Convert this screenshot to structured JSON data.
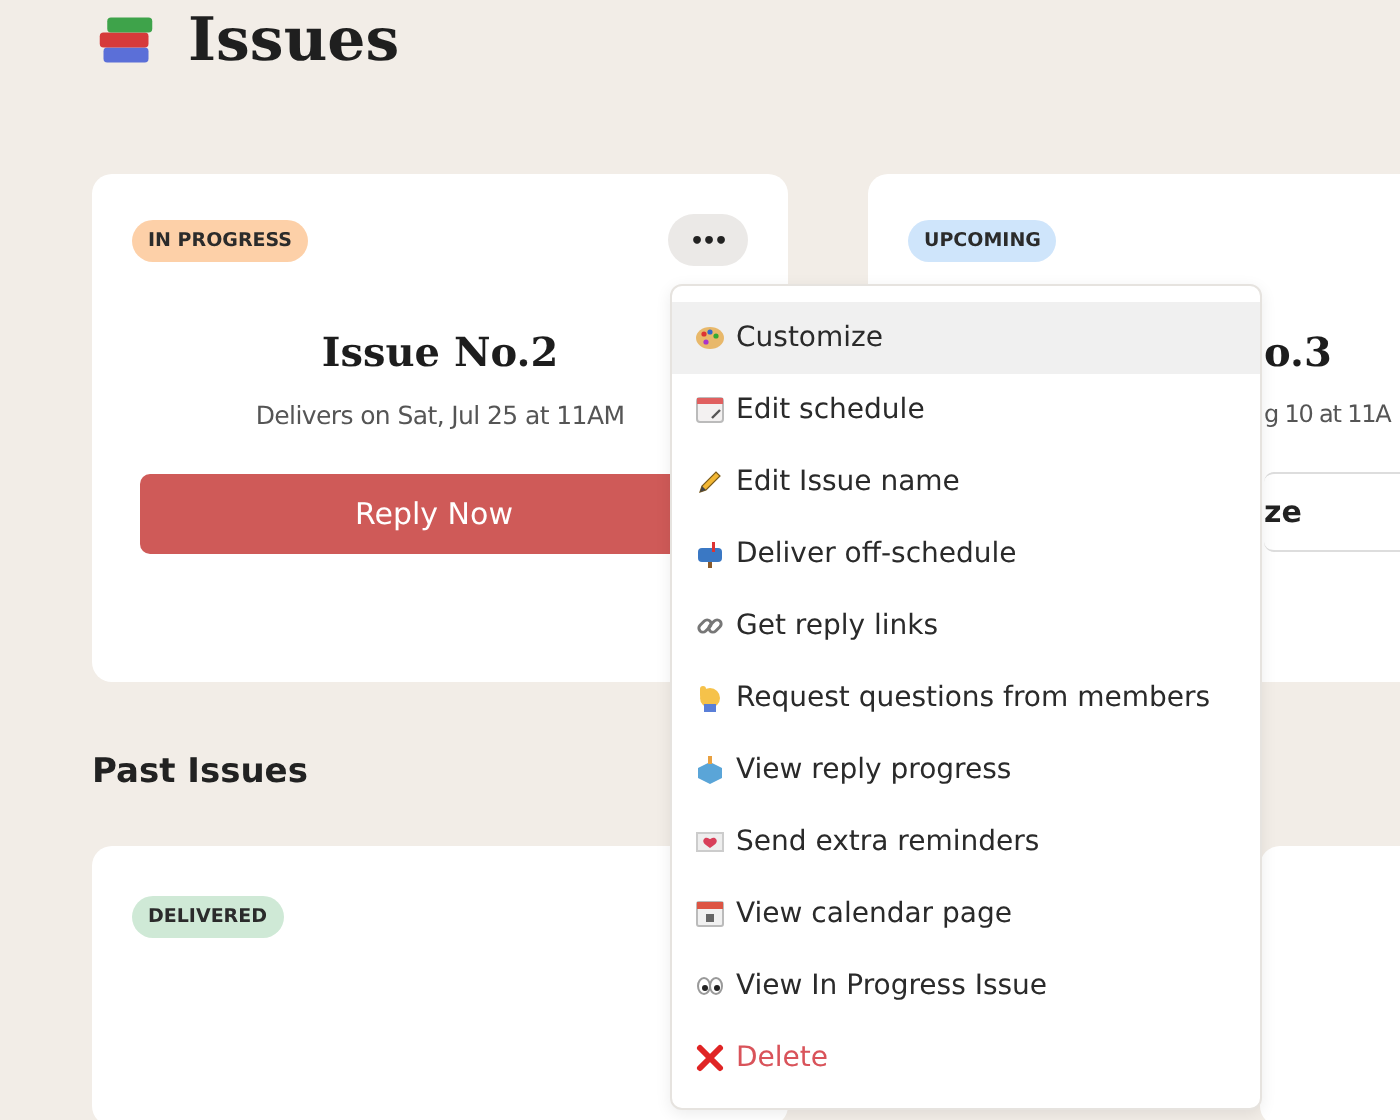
{
  "page": {
    "title": "Issues"
  },
  "current_issues": [
    {
      "badge": {
        "label": "IN PROGRESS",
        "color": "#fdd0a8"
      },
      "menu_button": "•••",
      "title": "Issue No.2",
      "schedule": "Delivers on Sat, Jul 25 at 11AM",
      "action": {
        "label": "Reply Now",
        "kind": "primary"
      }
    },
    {
      "badge": {
        "label": "UPCOMING",
        "color": "#cfe5fb"
      },
      "title": "o.3",
      "schedule": "g 10 at 11A",
      "action": {
        "label": "ze",
        "kind": "outline"
      }
    }
  ],
  "past_heading": "Past Issues",
  "past_issues": [
    {
      "badge": {
        "label": "DELIVERED",
        "color": "#cfe9d6"
      }
    }
  ],
  "menu": {
    "items": [
      {
        "label": "Customize",
        "kind": "normal",
        "selected": true
      },
      {
        "label": "Edit schedule",
        "kind": "normal",
        "selected": false
      },
      {
        "label": "Edit Issue name",
        "kind": "normal",
        "selected": false
      },
      {
        "label": "Deliver off-schedule",
        "kind": "normal",
        "selected": false
      },
      {
        "label": "Get reply links",
        "kind": "normal",
        "selected": false
      },
      {
        "label": "Request questions from members",
        "kind": "normal",
        "selected": false
      },
      {
        "label": "View reply progress",
        "kind": "normal",
        "selected": false
      },
      {
        "label": "Send extra reminders",
        "kind": "normal",
        "selected": false
      },
      {
        "label": "View calendar page",
        "kind": "normal",
        "selected": false
      },
      {
        "label": "View In Progress Issue",
        "kind": "normal",
        "selected": false
      },
      {
        "label": "Delete",
        "kind": "danger",
        "selected": false
      }
    ]
  }
}
